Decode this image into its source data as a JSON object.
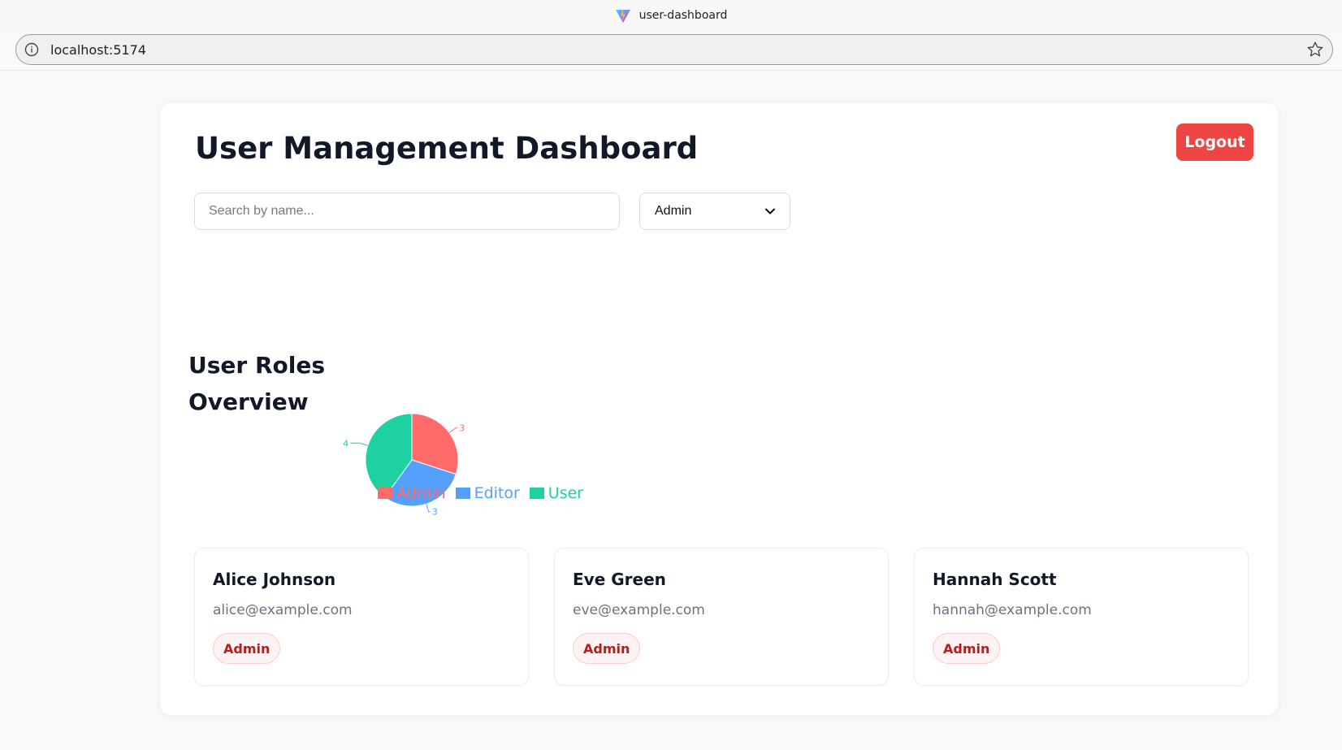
{
  "browser": {
    "tab_title": "user-dashboard",
    "url": "localhost:5174"
  },
  "header": {
    "title": "User Management Dashboard",
    "logout_label": "Logout"
  },
  "filters": {
    "search_placeholder": "Search by name...",
    "search_value": "",
    "role_selected": "Admin"
  },
  "chart_section": {
    "heading": "User Roles Overview"
  },
  "chart_data": {
    "type": "pie",
    "slices": [
      {
        "name": "Admin",
        "value": 3,
        "color": "#ff6b6b"
      },
      {
        "name": "Editor",
        "value": 3,
        "color": "#54a0ff"
      },
      {
        "name": "User",
        "value": 4,
        "color": "#1dd1a1"
      }
    ],
    "legend_position": "bottom"
  },
  "users": [
    {
      "name": "Alice Johnson",
      "email": "alice@example.com",
      "role": "Admin"
    },
    {
      "name": "Eve Green",
      "email": "eve@example.com",
      "role": "Admin"
    },
    {
      "name": "Hannah Scott",
      "email": "hannah@example.com",
      "role": "Admin"
    }
  ],
  "colors": {
    "accent_red": "#ef4444",
    "badge_bg": "#fef2f2",
    "badge_text": "#b91c1c"
  },
  "icons": {
    "favicon": "vite-logo-icon",
    "site_info": "info-icon",
    "bookmark": "star-icon",
    "select_arrow": "chevron-down-icon"
  }
}
